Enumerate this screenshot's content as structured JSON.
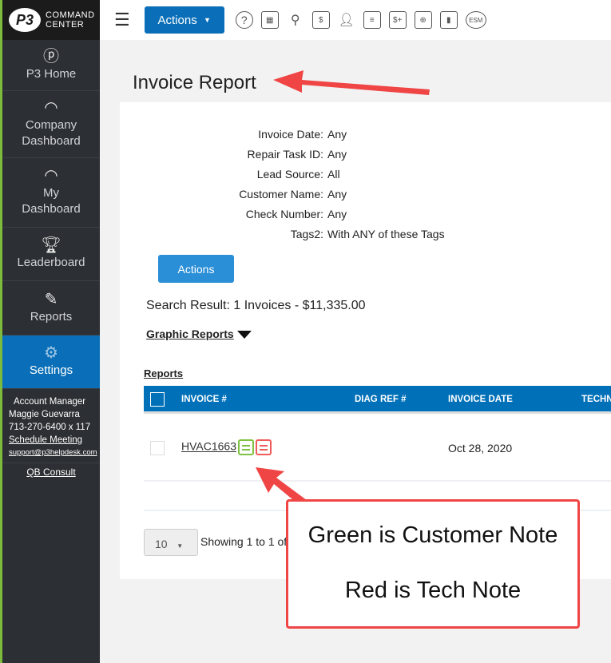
{
  "logo": {
    "mark": "P3",
    "line1": "COMMAND",
    "line2": "CENTER"
  },
  "sidebar": {
    "items": [
      {
        "label": "P3 Home",
        "icon": "p3-logo-icon"
      },
      {
        "label": "Company Dashboard",
        "icon": "gauge-icon"
      },
      {
        "label": "My Dashboard",
        "icon": "gauge-icon"
      },
      {
        "label": "Leaderboard",
        "icon": "trophy-icon"
      },
      {
        "label": "Reports",
        "icon": "report-icon"
      },
      {
        "label": "Settings",
        "icon": "gear-icon",
        "active": true
      }
    ],
    "account": {
      "title": "Account Manager",
      "name": "Maggie Guevarra",
      "phone": "713-270-6400 x 117",
      "schedule": "Schedule Meeting",
      "email": "support@p3helpdesk.com",
      "qb": "QB Consult"
    }
  },
  "toolbar": {
    "actions": "Actions",
    "icons": [
      "help-icon",
      "calendar-icon",
      "search-user-icon",
      "search-sales-icon",
      "add-user-icon",
      "copy-docs-icon",
      "add-invoice-icon",
      "add-schedule-icon",
      "bar-chart-icon",
      "esm-icon"
    ],
    "esm": "ESM"
  },
  "page": {
    "title": "Invoice Report"
  },
  "filters": [
    {
      "label": "Invoice Date:",
      "value": "Any"
    },
    {
      "label": "Repair Task ID:",
      "value": "Any"
    },
    {
      "label": "Lead Source:",
      "value": "All"
    },
    {
      "label": "Customer Name:",
      "value": "Any"
    },
    {
      "label": "Check Number:",
      "value": "Any"
    },
    {
      "label": "Tags2:",
      "value": "With ANY of these Tags"
    }
  ],
  "actions_button": "Actions",
  "search_result": "Search Result: 1 Invoices - $11,335.00",
  "graphic_reports": "Graphic Reports",
  "reports_link": "Reports",
  "table": {
    "columns": [
      "INVOICE #",
      "DIAG REF #",
      "INVOICE DATE",
      "TECHN"
    ],
    "rows": [
      {
        "invoice": "HVAC1663",
        "diag": "",
        "date": "Oct 28, 2020"
      }
    ]
  },
  "pagination": {
    "page_size": "10",
    "showing": "Showing 1 to 1 of"
  },
  "colors": {
    "customer_note": "#7dc242",
    "tech_note": "#f05a5a",
    "primary": "#0070b8",
    "annotation": "#f04545"
  },
  "annotation": {
    "line1": "Green is Customer Note",
    "line2": "Red is Tech Note"
  }
}
